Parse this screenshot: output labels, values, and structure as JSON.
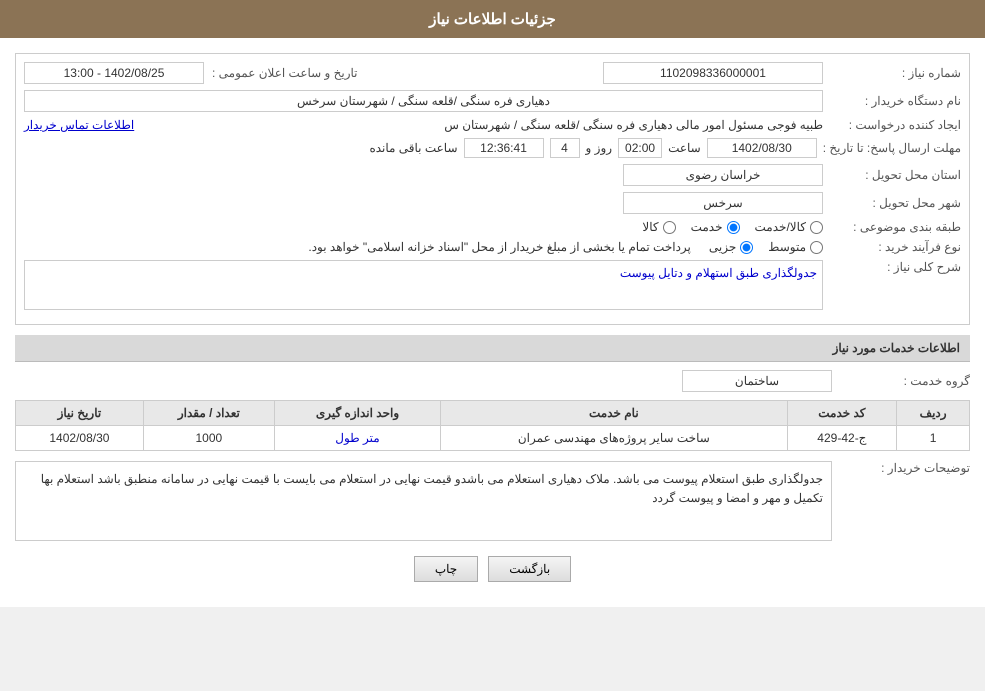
{
  "header": {
    "title": "جزئیات اطلاعات نیاز"
  },
  "fields": {
    "shomareNiaz_label": "شماره نیاز :",
    "shomareNiaz_value": "1102098336000001",
    "namDastgah_label": "نام دستگاه خریدار :",
    "namDastgah_value": "دهیاری فره سنگی /قلعه سنگی / شهرستان سرخس",
    "ijadKonande_label": "ایجاد کننده درخواست :",
    "ijadKonande_value": "طبیه فوجی مسئول امور مالی دهیاری فره سنگی /قلعه سنگی / شهرستان س",
    "ijadKonande_link": "اطلاعات تماس خریدار",
    "mohlatErsal_label": "مهلت ارسال پاسخ: تا تاریخ :",
    "date_value": "1402/08/30",
    "saat_label": "ساعت",
    "saat_value": "02:00",
    "rooz_label": "روز و",
    "rooz_value": "4",
    "baghimande_label": "ساعت باقی مانده",
    "baghimande_value": "12:36:41",
    "ostan_label": "استان محل تحویل :",
    "ostan_value": "خراسان رضوی",
    "shahr_label": "شهر محل تحویل :",
    "shahr_value": "سرخس",
    "tabaghe_label": "طبقه بندی موضوعی :",
    "tabaghe_kala": "کالا",
    "tabaghe_khadamat": "خدمت",
    "tabaghe_kala_khadamat": "کالا/خدمت",
    "tabaghe_selected": "khadamat",
    "noeFarayand_label": "نوع فرآیند خرید :",
    "jozei": "جزیی",
    "motavasset": "متوسط",
    "farayand_note": "پرداخت تمام یا بخشی از مبلغ خریدار از محل \"اسناد خزانه اسلامی\" خواهد بود.",
    "sharhKoli_label": "شرح کلی نیاز :",
    "sharhKoli_value": "جدولگذاری طبق استهلام و دتایل پیوست",
    "khadamat_section": "اطلاعات خدمات مورد نیاز",
    "grohe_label": "گروه خدمت :",
    "grohe_value": "ساختمان",
    "table": {
      "col_radif": "ردیف",
      "col_kod": "کد خدمت",
      "col_name": "نام خدمت",
      "col_unit": "واحد اندازه گیری",
      "col_tedad": "تعداد / مقدار",
      "col_tarikh": "تاریخ نیاز",
      "rows": [
        {
          "radif": "1",
          "kod": "ج-42-429",
          "name": "ساخت سایر پروژه‌های مهندسی عمران",
          "unit": "متر طول",
          "tedad": "1000",
          "tarikh": "1402/08/30"
        }
      ]
    },
    "tosihKharidar_label": "توضیحات خریدار :",
    "tosihKharidar_value": "جدولگذاری طبق استعلام  پیوست می باشد. ملاک  دهیاری استعلام  می باشدو قیمت نهایی در استعلام می بایست با قیمت  نهایی در سامانه  منطبق باشد استعلام  بها  تکمیل  و مهر و امضا و پیوست  گردد",
    "buttons": {
      "chap": "چاپ",
      "bazgasht": "بازگشت"
    },
    "tarikh_label": "تاریخ و ساعت اعلان عمومی :",
    "tarikh_range": "1402/08/25 - 13:00"
  }
}
